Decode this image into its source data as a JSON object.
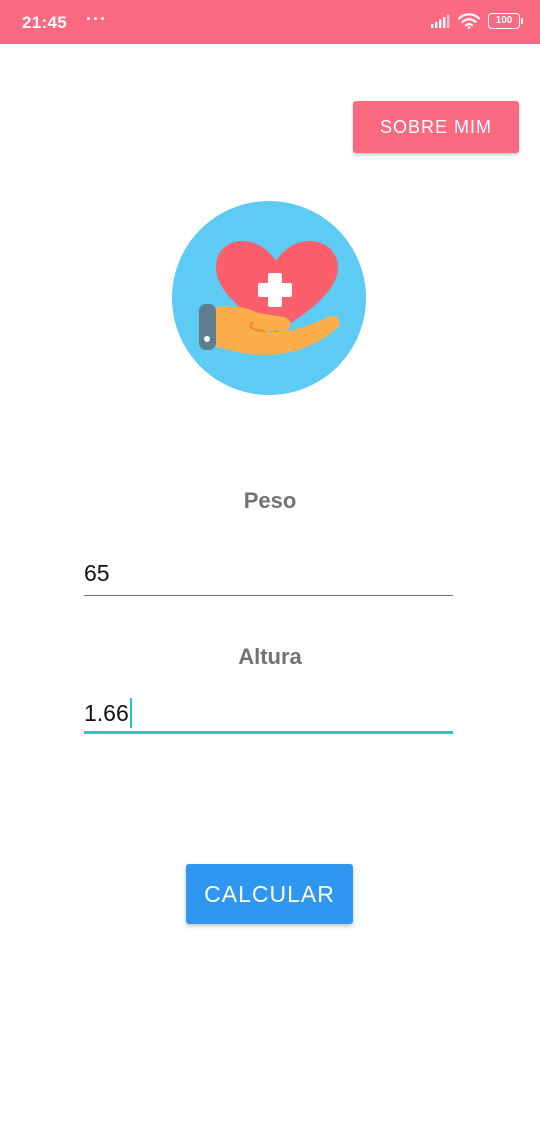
{
  "status_bar": {
    "time": "21:45",
    "dots": "···",
    "battery": "100",
    "icons": [
      "signal-icon",
      "wifi-icon",
      "battery-icon"
    ]
  },
  "header": {
    "about_button": "SOBRE MIM"
  },
  "form": {
    "weight_label": "Peso",
    "weight_value": "65",
    "height_label": "Altura",
    "height_value": "1.66",
    "calculate_button": "CALCULAR"
  },
  "colors": {
    "accent": "#fb6a80",
    "primary": "#2f97f0",
    "focus": "#25c8be",
    "logo_circle": "#5ecbf5"
  }
}
